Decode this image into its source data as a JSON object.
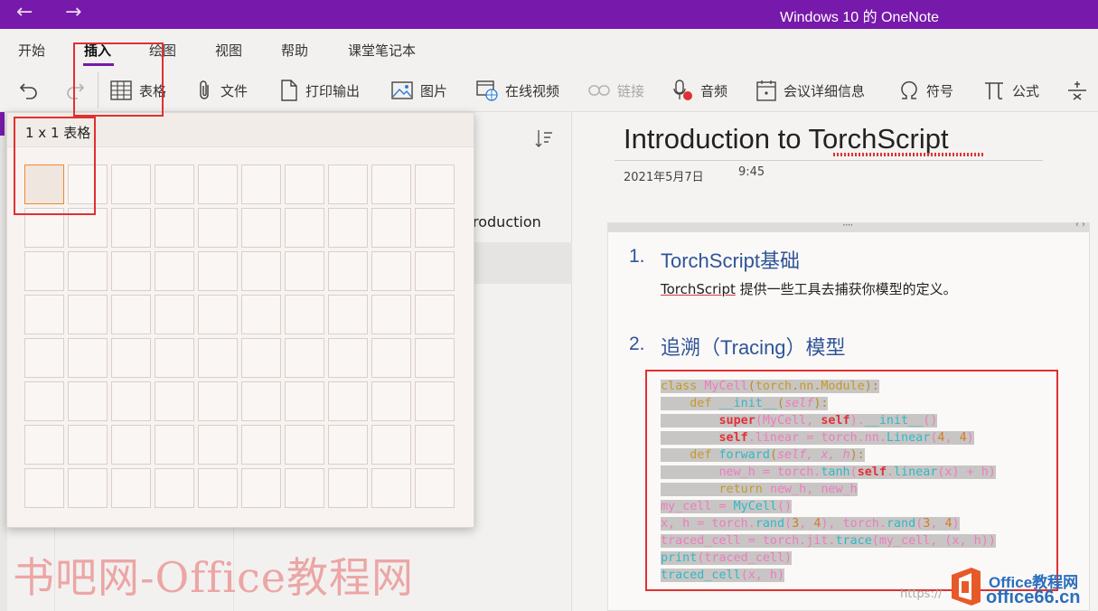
{
  "titlebar": {
    "title": "Windows 10 的 OneNote",
    "back_icon": "←",
    "forward_icon": "→"
  },
  "ribbon": {
    "tabs": [
      {
        "label": "开始"
      },
      {
        "label": "插入",
        "active": true
      },
      {
        "label": "绘图"
      },
      {
        "label": "视图"
      },
      {
        "label": "帮助"
      },
      {
        "label": "课堂笔记本"
      }
    ],
    "tools": {
      "table": "表格",
      "file": "文件",
      "printout": "打印输出",
      "picture": "图片",
      "online_video": "在线视频",
      "link": "链接",
      "audio": "音频",
      "meeting": "会议详细信息",
      "symbol": "符号",
      "equation": "公式"
    }
  },
  "table_popup": {
    "header": "1 x 1 表格",
    "rows": 8,
    "cols": 10,
    "selected_rows": 1,
    "selected_cols": 1
  },
  "page_list": {
    "item_partial": "roduction"
  },
  "page": {
    "title": "Introduction to TorchScript",
    "date": "2021年5月7日",
    "time": "9:45",
    "handle_dots": "····",
    "handle_arrows": "‹ ›",
    "heading1_num": "1.",
    "heading1": "TorchScript基础",
    "body1_a": "TorchScript",
    "body1_b": " 提供一些工具去捕获你模型的定义。",
    "heading2_num": "2.",
    "heading2": "追溯（Tracing）模型"
  },
  "watermark": {
    "left": "书吧网-Office教程网",
    "right_top": "Office教程网",
    "right_bottom": "office66.cn",
    "url": "https://"
  },
  "colors": {
    "accent": "#7719aa",
    "annotation": "#e03030",
    "heading": "#2f5597"
  }
}
